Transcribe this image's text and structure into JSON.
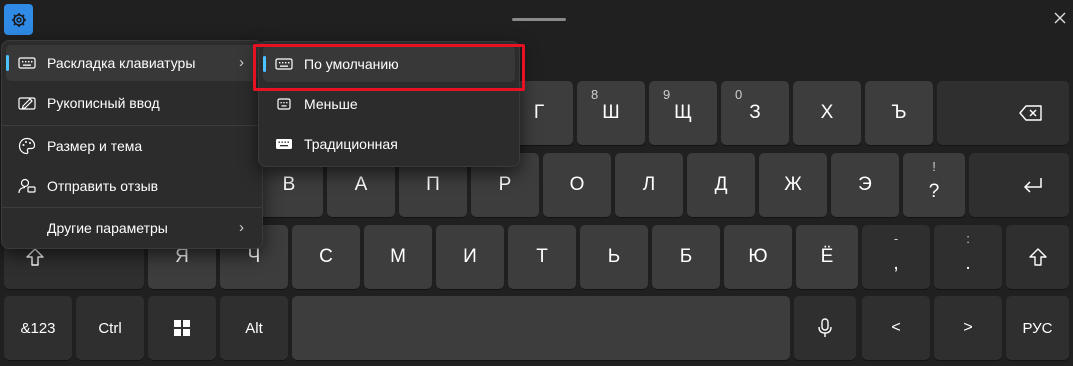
{
  "keyboard": {
    "row1_tail": [
      {
        "main": "Г",
        "sec": ""
      },
      {
        "main": "Ш",
        "sec": "8"
      },
      {
        "main": "Щ",
        "sec": "9"
      },
      {
        "main": "З",
        "sec": "0"
      },
      {
        "main": "Х",
        "sec": ""
      },
      {
        "main": "Ъ",
        "sec": ""
      }
    ],
    "row2": [
      "В",
      "А",
      "П",
      "Р",
      "О",
      "Л",
      "Д",
      "Ж",
      "Э"
    ],
    "row2_punct": {
      "main": "?",
      "sec": "!"
    },
    "row3": [
      "Я",
      "Ч",
      "С",
      "М",
      "И",
      "Т",
      "Ь",
      "Б",
      "Ю",
      "Ё"
    ],
    "row3_comma": {
      "main": ",",
      "sec": "-"
    },
    "row3_period": {
      "main": ".",
      "sec": ":"
    },
    "bottom": {
      "symbols": "&123",
      "ctrl": "Ctrl",
      "alt": "Alt",
      "left": "<",
      "right": ">",
      "lang": "РУС"
    }
  },
  "main_menu": {
    "items": [
      {
        "label": "Раскладка клавиатуры",
        "icon": "keyboard-icon",
        "has_submenu": true
      },
      {
        "label": "Рукописный ввод",
        "icon": "pen-handwriting-icon",
        "has_submenu": false
      },
      {
        "label": "Размер и тема",
        "icon": "palette-icon",
        "has_submenu": false
      },
      {
        "label": "Отправить отзыв",
        "icon": "feedback-icon",
        "has_submenu": false
      },
      {
        "label": "Другие параметры",
        "icon": "",
        "has_submenu": true
      }
    ]
  },
  "layout_submenu": {
    "items": [
      {
        "label": "По умолчанию",
        "icon": "keyboard-default-icon"
      },
      {
        "label": "Меньше",
        "icon": "keyboard-small-icon"
      },
      {
        "label": "Традиционная",
        "icon": "keyboard-traditional-icon"
      }
    ]
  },
  "colors": {
    "accent": "#4cc2ff",
    "settings_button": "#2f8be6",
    "highlight": "#e81123",
    "key": "#3d3d3d",
    "key_dark": "#2f2f2f",
    "background": "#202020"
  }
}
